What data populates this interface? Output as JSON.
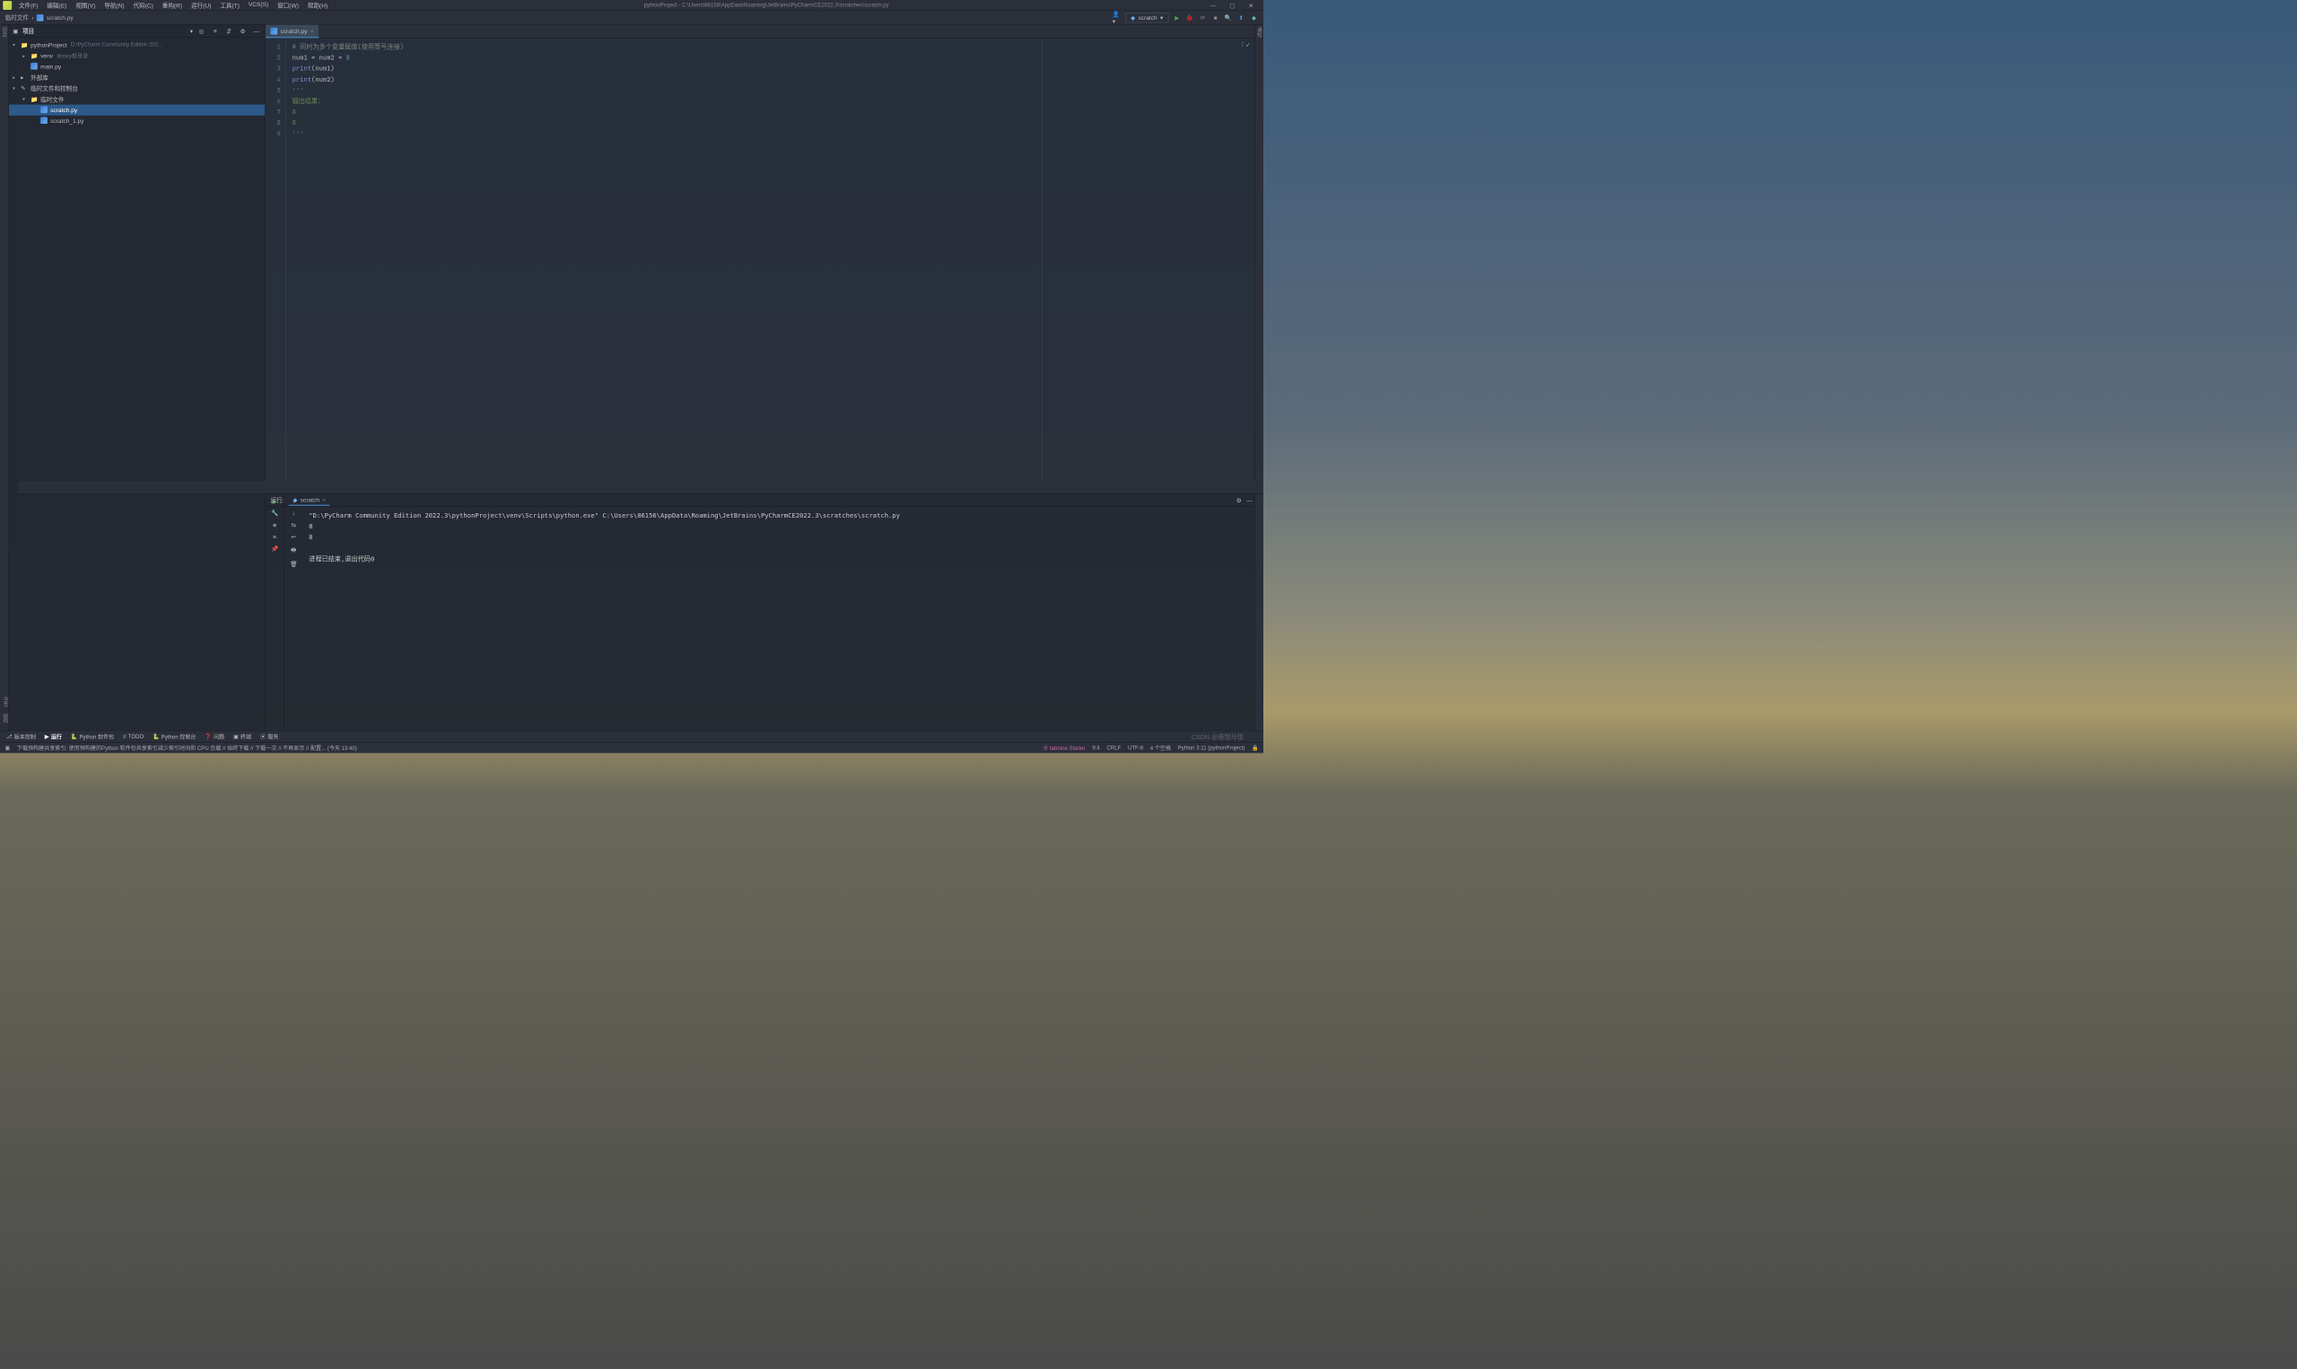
{
  "window": {
    "title": "pythonProject - C:\\Users\\86156\\AppData\\Roaming\\JetBrains\\PyCharmCE2022.3\\scratches\\scratch.py"
  },
  "menu": [
    "文件(F)",
    "编辑(E)",
    "视图(V)",
    "导航(N)",
    "代码(C)",
    "重构(R)",
    "运行(U)",
    "工具(T)",
    "VCS(S)",
    "窗口(W)",
    "帮助(H)"
  ],
  "breadcrumb": [
    "临时文件",
    "scratch.py"
  ],
  "run_config": {
    "name": "scratch"
  },
  "project_panel": {
    "title": "项目",
    "tree": [
      {
        "level": 0,
        "chev": "▾",
        "icon": "folder",
        "name": "pythonProject",
        "hint": "D:\\PyCharm Community Edition 202..."
      },
      {
        "level": 1,
        "chev": "▸",
        "icon": "folder",
        "name": "venv",
        "hint": "library根目录"
      },
      {
        "level": 1,
        "chev": "",
        "icon": "py",
        "name": "main.py"
      },
      {
        "level": 0,
        "chev": "▸",
        "icon": "lib",
        "name": "外部库"
      },
      {
        "level": 0,
        "chev": "▾",
        "icon": "scratch",
        "name": "临时文件和控制台"
      },
      {
        "level": 1,
        "chev": "▾",
        "icon": "folder",
        "name": "临时文件"
      },
      {
        "level": 2,
        "chev": "",
        "icon": "py",
        "name": "scratch.py",
        "selected": true
      },
      {
        "level": 2,
        "chev": "",
        "icon": "py",
        "name": "scratch_1.py"
      }
    ]
  },
  "editor": {
    "tab": "scratch.py",
    "lines": [
      {
        "n": 1,
        "html": "<span class='c-cmt'># 同时为多个变量赋值(使用等号连接)</span>"
      },
      {
        "n": 2,
        "html": "num1 = num2 = <span class='c-num'>8</span>"
      },
      {
        "n": 3,
        "html": "<span class='c-print'>print</span>(num1)"
      },
      {
        "n": 4,
        "html": "<span class='c-print'>print</span>(num2)"
      },
      {
        "n": 5,
        "html": "<span class='c-str'>'''</span>"
      },
      {
        "n": 6,
        "html": "<span class='c-str'>输出结果：</span>"
      },
      {
        "n": 7,
        "html": "<span class='c-str'>8</span>"
      },
      {
        "n": 8,
        "html": "<span class='c-str'>8</span>"
      },
      {
        "n": 9,
        "html": "<span class='c-str'>'''</span>"
      }
    ]
  },
  "run_panel": {
    "label": "运行:",
    "tab": "scratch",
    "output": "\"D:\\PyCharm Community Edition 2022.3\\pythonProject\\venv\\Scripts\\python.exe\" C:\\Users\\86156\\AppData\\Roaming\\JetBrains\\PyCharmCE2022.3\\scratches\\scratch.py\n8\n8\n\n进程已结束,退出代码0"
  },
  "bottom_tabs": [
    {
      "icon": "⎇",
      "label": "版本控制"
    },
    {
      "icon": "▶",
      "label": "运行",
      "active": true
    },
    {
      "icon": "🐍",
      "label": "Python 软件包"
    },
    {
      "icon": "≡",
      "label": "TODO"
    },
    {
      "icon": "🐍",
      "label": "Python 控制台"
    },
    {
      "icon": "❓",
      "label": "问题"
    },
    {
      "icon": "▣",
      "label": "终端"
    },
    {
      "icon": "⦿",
      "label": "服务"
    }
  ],
  "statusbar": {
    "left": "下载预构建共享索引: 使用预构建的Python 软件包共享索引减少索引时间和 CPU 负载 // 始终下载 // 下载一次 // 不再显示 // 配置... (今天 13:40)",
    "items": [
      "tabnine Starter",
      "9:4",
      "CRLF",
      "UTF-8",
      "4 个空格",
      "Python 3.11 (pythonProject)"
    ]
  },
  "left_gutter_labels": [
    "项目"
  ],
  "right_gutter_labels": [
    "通知"
  ],
  "vertical_left_labels": [
    "书签",
    "结构"
  ],
  "watermark": "CSDN @夜悦玲珑"
}
